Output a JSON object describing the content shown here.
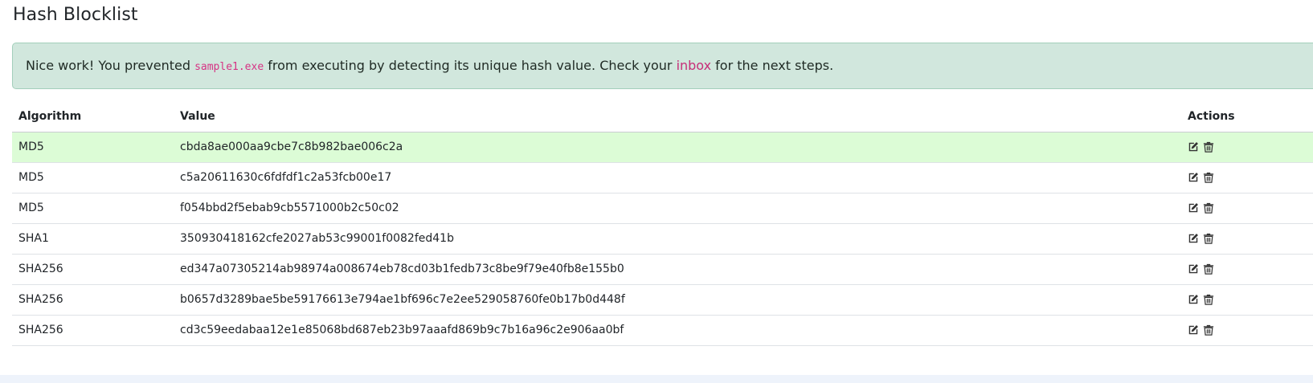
{
  "page": {
    "title": "Hash Blocklist"
  },
  "alert": {
    "text_before": "Nice work! You prevented ",
    "filename": "sample1.exe",
    "text_middle": " from executing by detecting its unique hash value. Check your ",
    "link_text": "inbox",
    "text_after": " for the next steps."
  },
  "table": {
    "headers": {
      "algorithm": "Algorithm",
      "value": "Value",
      "actions": "Actions"
    },
    "rows": [
      {
        "algorithm": "MD5",
        "value": "cbda8ae000aa9cbe7c8b982bae006c2a",
        "highlighted": true
      },
      {
        "algorithm": "MD5",
        "value": "c5a20611630c6fdfdf1c2a53fcb00e17",
        "highlighted": false
      },
      {
        "algorithm": "MD5",
        "value": "f054bbd2f5ebab9cb5571000b2c50c02",
        "highlighted": false
      },
      {
        "algorithm": "SHA1",
        "value": "350930418162cfe2027ab53c99001f0082fed41b",
        "highlighted": false
      },
      {
        "algorithm": "SHA256",
        "value": "ed347a07305214ab98974a008674eb78cd03b1fedb73c8be9f79e40fb8e155b0",
        "highlighted": false
      },
      {
        "algorithm": "SHA256",
        "value": "b0657d3289bae5be59176613e794ae1bf696c7e2ee529058760fe0b17b0d448f",
        "highlighted": false
      },
      {
        "algorithm": "SHA256",
        "value": "cd3c59eedabaa12e1e85068bd687eb23b97aaafd869b9c7b16a96c2e906aa0bf",
        "highlighted": false
      }
    ],
    "row_actions": [
      "edit-icon",
      "trash-icon"
    ]
  },
  "colors": {
    "alert_bg": "#d1e7dd",
    "alert_border": "#a3cfbb",
    "highlight_row": "#dcfcd6",
    "code_pink": "#d63384",
    "link_pink": "#c72d78"
  }
}
